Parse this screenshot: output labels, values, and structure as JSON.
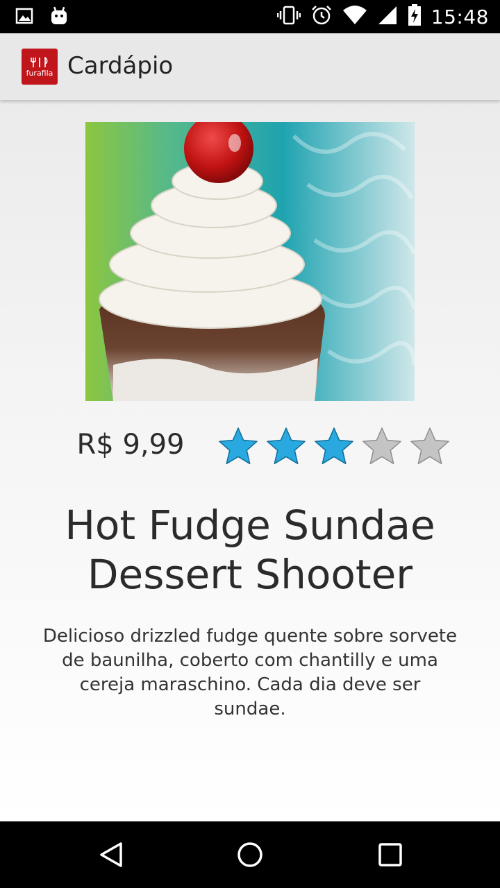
{
  "status_bar": {
    "time": "15:48",
    "left_icons": [
      "image-icon",
      "android-icon"
    ],
    "right_icons": [
      "vibrate-icon",
      "alarm-icon",
      "wifi-icon",
      "signal-icon",
      "battery-charging-icon"
    ]
  },
  "app_bar": {
    "logo_text": "furafila",
    "title": "Cardápio"
  },
  "product": {
    "price": "R$ 9,99",
    "rating": 3,
    "rating_max": 5,
    "name_line1": "Hot Fudge Sundae",
    "name_line2": "Dessert Shooter",
    "description": "Delicioso drizzled fudge quente sobre sorvete de baunilha, coberto com chantilly e uma cereja maraschino. Cada dia deve ser sundae."
  },
  "colors": {
    "star_filled": "#29a9e0",
    "star_empty": "#c4c4c4",
    "logo_red": "#c0161b"
  },
  "nav_bar": {
    "buttons": [
      "back-icon",
      "home-icon",
      "recents-icon"
    ]
  }
}
